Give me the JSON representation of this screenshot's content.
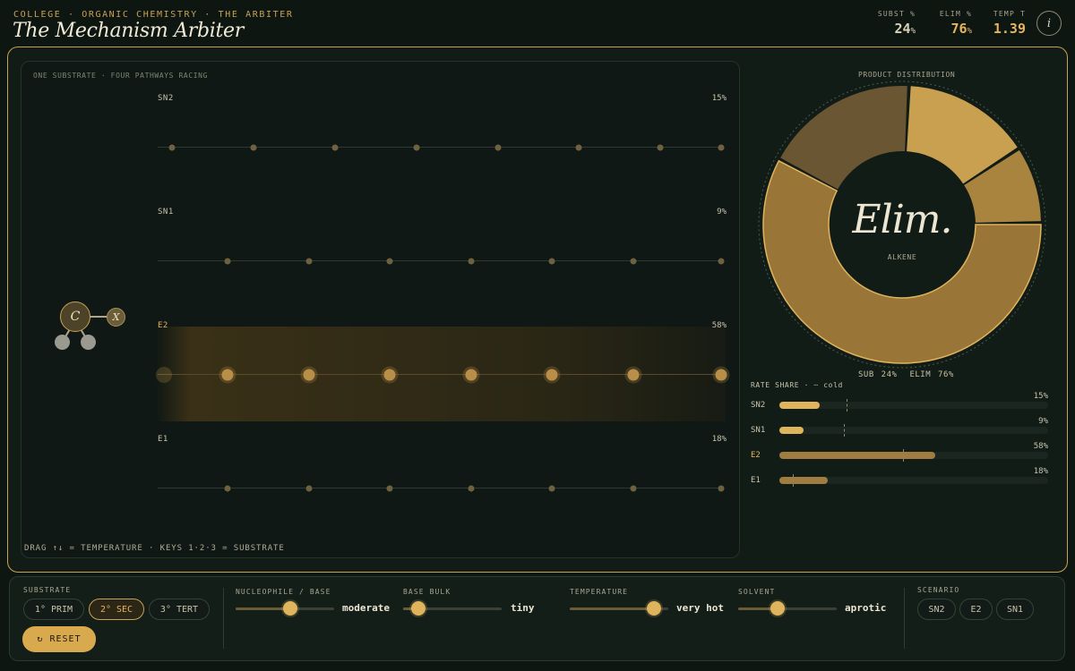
{
  "header": {
    "eyebrow": "COLLEGE · ORGANIC CHEMISTRY · THE ARBITER",
    "title": "The Mechanism Arbiter",
    "stats": [
      {
        "label": "SUBST %",
        "value": "24",
        "unit": "%"
      },
      {
        "label": "ELIM %",
        "value": "76",
        "unit": "%"
      },
      {
        "label": "TEMP T",
        "value": "1.39",
        "unit": ""
      }
    ],
    "info_glyph": "i"
  },
  "race": {
    "caption": "ONE SUBSTRATE · FOUR PATHWAYS RACING",
    "hint": "DRAG ↑↓ = TEMPERATURE · KEYS 1·2·3 = SUBSTRATE",
    "molecule": {
      "center_atom": "C",
      "leaving_group": "X"
    },
    "lanes": [
      {
        "name": "SN2",
        "pct": "15%",
        "dominant": false
      },
      {
        "name": "SN1",
        "pct": "9%",
        "dominant": false
      },
      {
        "name": "E2",
        "pct": "58%",
        "dominant": true
      },
      {
        "name": "E1",
        "pct": "18%",
        "dominant": false
      }
    ]
  },
  "distribution": {
    "caption": "PRODUCT DISTRIBUTION",
    "center_label": "Elim.",
    "center_sub": "ALKENE",
    "summary_sub": "SUB 24%",
    "summary_elim": "ELIM 76%",
    "slices": [
      {
        "name": "SN2",
        "value": 15
      },
      {
        "name": "SN1",
        "value": 9
      },
      {
        "name": "E2",
        "value": 58
      },
      {
        "name": "E1",
        "value": 18
      }
    ],
    "colors": [
      "#c9a050",
      "#a9843f",
      "#9a7538",
      "#6b5633"
    ]
  },
  "rate_share": {
    "title": "RATE SHARE  ·  ┄ cold",
    "rows": [
      {
        "name": "SN2",
        "pct": "15%",
        "share": 0.15,
        "cold": 0.25
      },
      {
        "name": "SN1",
        "pct": "9%",
        "share": 0.09,
        "cold": 0.24
      },
      {
        "name": "E2",
        "pct": "58%",
        "share": 0.58,
        "cold": 0.46
      },
      {
        "name": "E1",
        "pct": "18%",
        "share": 0.18,
        "cold": 0.05
      }
    ]
  },
  "controls": {
    "substrate": {
      "label": "SUBSTRATE",
      "options": [
        "1° PRIM",
        "2° SEC",
        "3° TERT"
      ],
      "active": 1
    },
    "nucleophile": {
      "label": "NUCLEOPHILE / BASE",
      "value": "moderate",
      "level": 0.55
    },
    "bulk": {
      "label": "BASE BULK",
      "value": "tiny",
      "level": 0.15
    },
    "temperature": {
      "label": "TEMPERATURE",
      "value": "very hot",
      "level": 0.85
    },
    "solvent": {
      "label": "SOLVENT",
      "value": "aprotic",
      "level": 0.4
    },
    "scenario": {
      "label": "SCENARIO",
      "options": [
        "SN2",
        "E2",
        "SN1"
      ]
    },
    "reset_label": "↻ RESET"
  }
}
